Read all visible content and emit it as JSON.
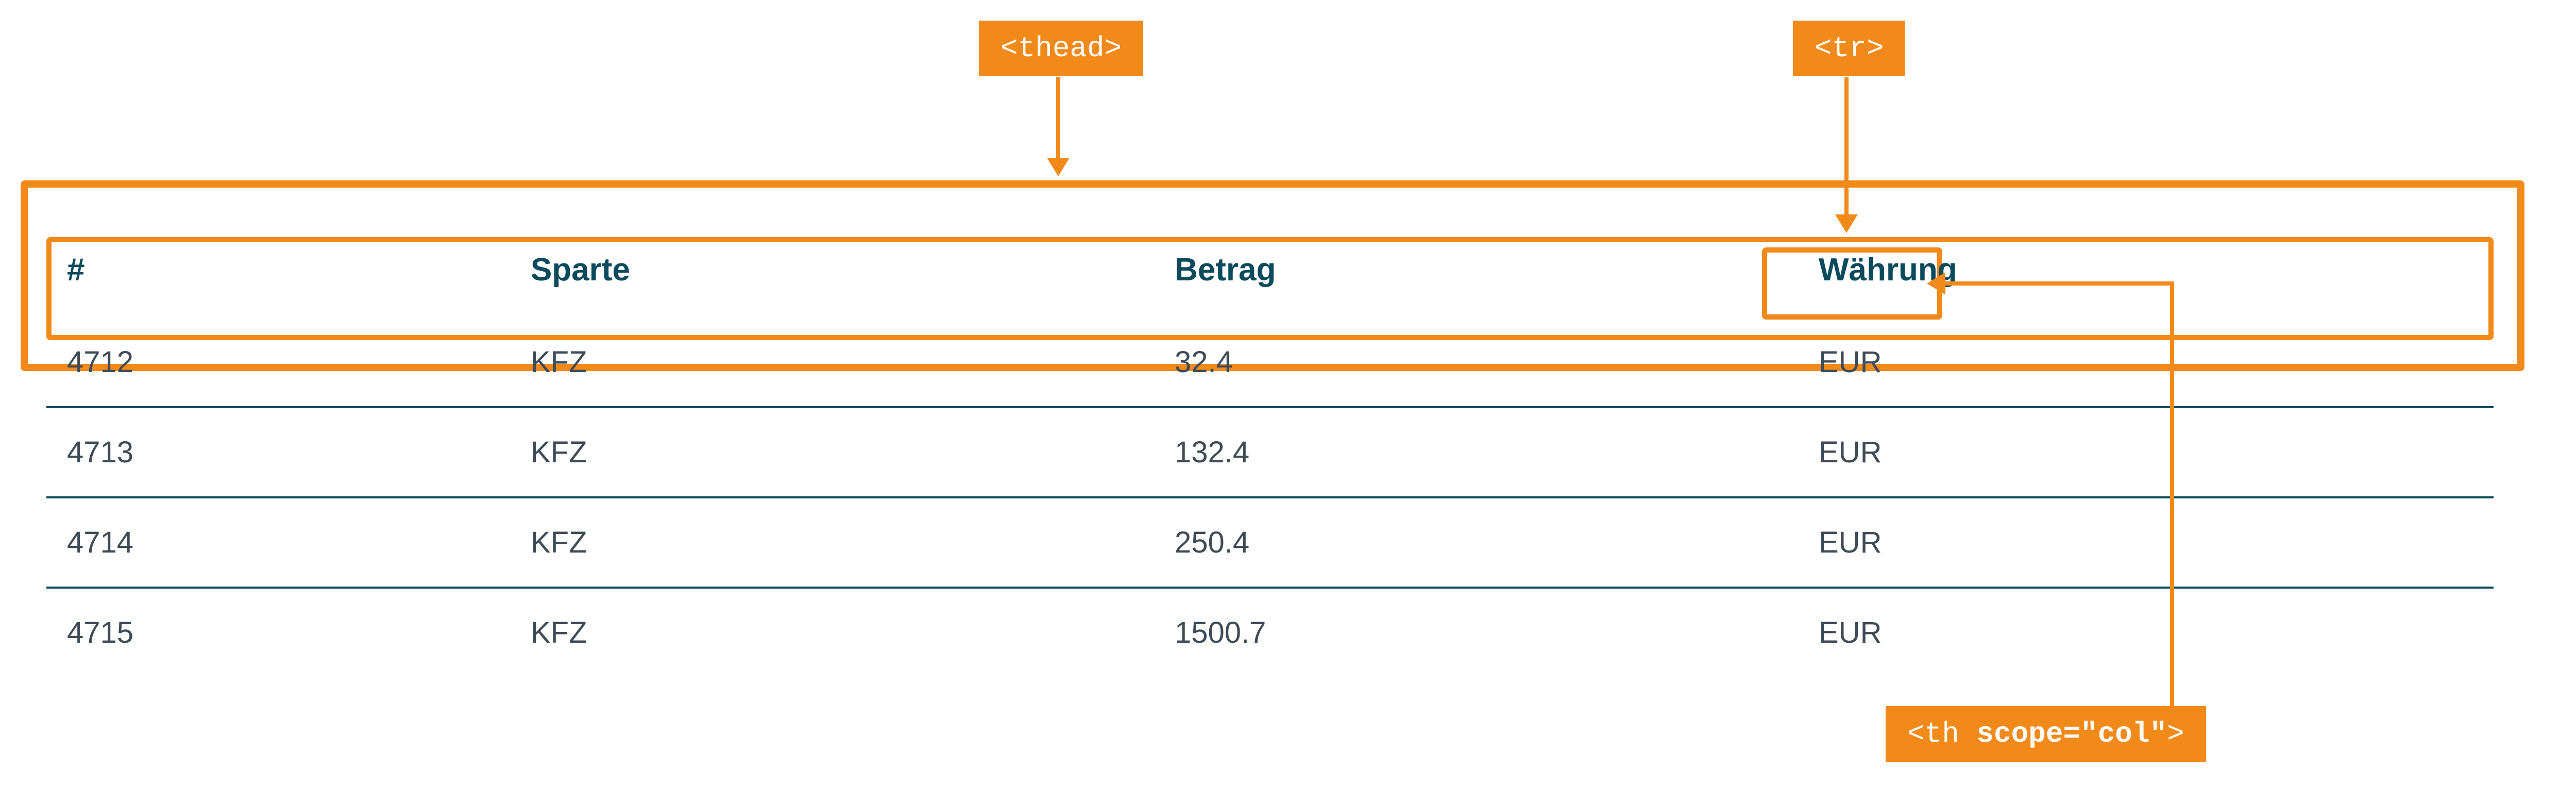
{
  "callouts": {
    "thead": "<thead>",
    "tr": "<tr>",
    "th_scope_prefix": "<th ",
    "th_scope_bold": "scope=\"col\"",
    "th_scope_suffix": ">"
  },
  "table": {
    "headers": {
      "id": "#",
      "division": "Sparte",
      "amount": "Betrag",
      "currency": "Währung"
    },
    "rows": [
      {
        "id": "4712",
        "division": "KFZ",
        "amount": "32.4",
        "currency": "EUR"
      },
      {
        "id": "4713",
        "division": "KFZ",
        "amount": "132.4",
        "currency": "EUR"
      },
      {
        "id": "4714",
        "division": "KFZ",
        "amount": "250.4",
        "currency": "EUR"
      },
      {
        "id": "4715",
        "division": "KFZ",
        "amount": "1500.7",
        "currency": "EUR"
      }
    ]
  },
  "colors": {
    "accent": "#f28a1a",
    "heading": "#0a4a5c",
    "body": "#3f4b56"
  }
}
